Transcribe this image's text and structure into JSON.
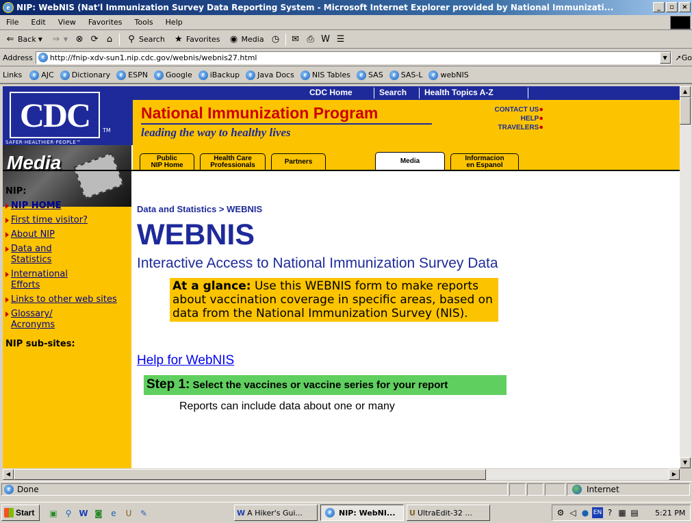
{
  "window": {
    "title": "NIP: WebNIS (Nat'l Immunization Survey Data Reporting System - Microsoft Internet Explorer provided by National Immunizati..."
  },
  "menu": [
    "File",
    "Edit",
    "View",
    "Favorites",
    "Tools",
    "Help"
  ],
  "toolbar": {
    "back": "Back",
    "search": "Search",
    "favorites": "Favorites",
    "media": "Media"
  },
  "address": {
    "label": "Address",
    "url": "http://fnip-xdv-sun1.nip.cdc.gov/webnis/webnis27.html",
    "go": "Go"
  },
  "links": {
    "label": "Links",
    "items": [
      "AJC",
      "Dictionary",
      "ESPN",
      "Google",
      "iBackup",
      "Java Docs",
      "NIS Tables",
      "SAS",
      "SAS-L",
      "webNIS"
    ]
  },
  "cdc": {
    "logo": "CDC",
    "tm": "TM",
    "safer": "SAFER·HEALTHIER·PEOPLE™"
  },
  "topnav": {
    "home": "CDC Home",
    "search": "Search",
    "topics": "Health Topics A-Z"
  },
  "banner": {
    "title": "National Immunization Program",
    "tagline": "leading the way to healthy lives",
    "contact": "Contact Us",
    "help": "Help",
    "travelers": "Travelers"
  },
  "tabs": [
    {
      "l1": "Public",
      "l2": "NIP Home"
    },
    {
      "l1": "Health Care",
      "l2": "Professionals"
    },
    {
      "l1": "Partners",
      "l2": ""
    },
    {
      "l1": "Media",
      "l2": ""
    },
    {
      "l1": "Informacion",
      "l2": "en Espanol"
    }
  ],
  "media_label": "Media",
  "leftnav": {
    "header": "NIP:",
    "items": [
      "NIP HOME",
      "First time visitor?",
      "About NIP",
      "Data and Statistics",
      "International Efforts",
      "Links to other web sites",
      "Glossary/ Acronyms"
    ],
    "subheader": "NIP sub-sites:"
  },
  "content": {
    "breadcrumb": "Data and Statistics > WEBNIS",
    "title": "WEBNIS",
    "subtitle": "Interactive Access to National Immunization Survey Data",
    "glance_label": "At a glance:",
    "glance_text": " Use this WEBNIS form to make reports about vaccination coverage in specific areas, based on data from the National Immunization Survey (NIS).",
    "help_link": "Help for WebNIS",
    "step_num": "Step 1:",
    "step_text": " Select the vaccines or vaccine series for your report",
    "reports_text": "Reports can include data about one or many"
  },
  "status": {
    "text": "Done",
    "zone": "Internet"
  },
  "taskbar": {
    "start": "Start",
    "tasks": [
      "A Hiker's Gui...",
      "NIP: WebNI...",
      "UltraEdit-32 ..."
    ],
    "time": "5:21 PM"
  }
}
